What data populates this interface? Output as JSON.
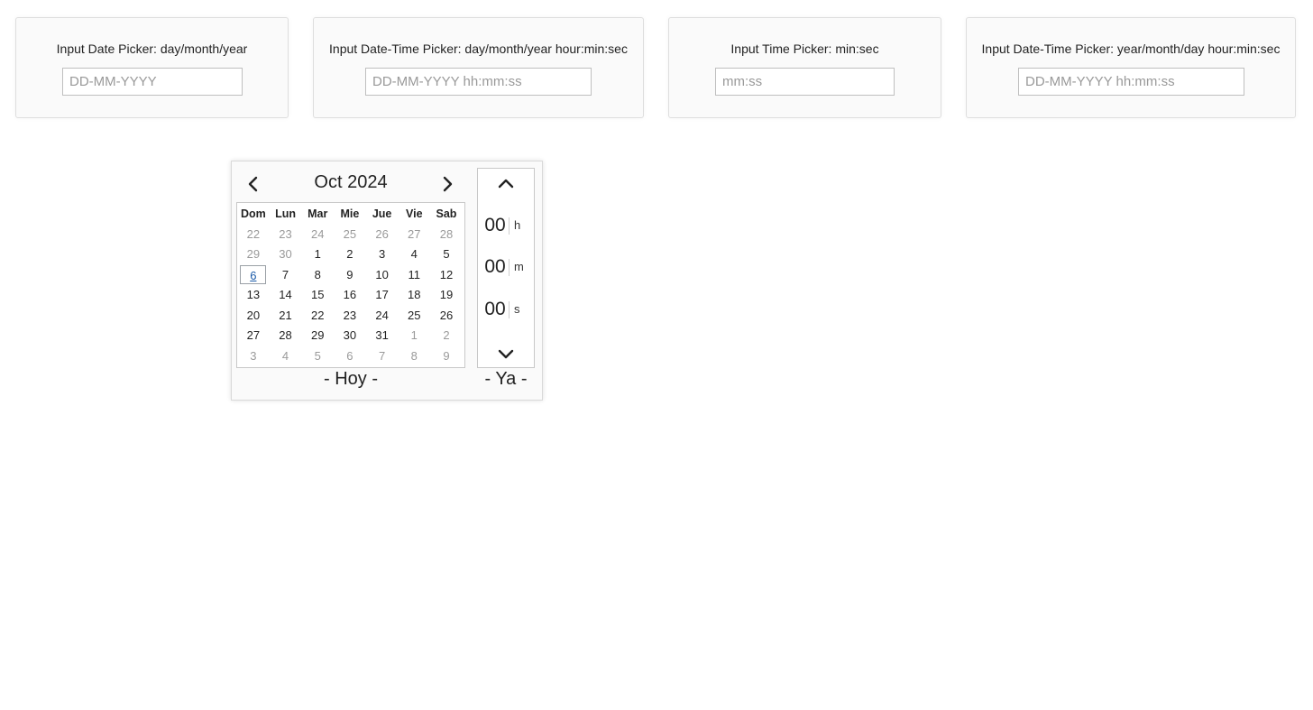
{
  "cards": [
    {
      "label": "Input Date Picker: day/month/year",
      "placeholder": "DD-MM-YYYY",
      "value": ""
    },
    {
      "label": "Input Date-Time Picker: day/month/year hour:min:sec",
      "placeholder": "DD-MM-YYYY hh:mm:ss",
      "value": ""
    },
    {
      "label": "Input Time Picker: min:sec",
      "placeholder": "mm:ss",
      "value": ""
    },
    {
      "label": "Input Date-Time Picker: year/month/day hour:min:sec",
      "placeholder": "DD-MM-YYYY hh:mm:ss",
      "value": ""
    }
  ],
  "picker": {
    "month_title": "Oct 2024",
    "prev_icon": "chevron-left-icon",
    "next_icon": "chevron-right-icon",
    "weekdays": [
      "Dom",
      "Lun",
      "Mar",
      "Mie",
      "Jue",
      "Vie",
      "Sab"
    ],
    "weeks": [
      [
        {
          "d": "22",
          "m": true
        },
        {
          "d": "23",
          "m": true
        },
        {
          "d": "24",
          "m": true
        },
        {
          "d": "25",
          "m": true
        },
        {
          "d": "26",
          "m": true
        },
        {
          "d": "27",
          "m": true
        },
        {
          "d": "28",
          "m": true
        }
      ],
      [
        {
          "d": "29",
          "m": true
        },
        {
          "d": "30",
          "m": true
        },
        {
          "d": "1"
        },
        {
          "d": "2"
        },
        {
          "d": "3"
        },
        {
          "d": "4"
        },
        {
          "d": "5"
        }
      ],
      [
        {
          "d": "6",
          "today": true
        },
        {
          "d": "7"
        },
        {
          "d": "8"
        },
        {
          "d": "9"
        },
        {
          "d": "10"
        },
        {
          "d": "11"
        },
        {
          "d": "12"
        }
      ],
      [
        {
          "d": "13"
        },
        {
          "d": "14"
        },
        {
          "d": "15"
        },
        {
          "d": "16"
        },
        {
          "d": "17"
        },
        {
          "d": "18"
        },
        {
          "d": "19"
        }
      ],
      [
        {
          "d": "20"
        },
        {
          "d": "21"
        },
        {
          "d": "22"
        },
        {
          "d": "23"
        },
        {
          "d": "24"
        },
        {
          "d": "25"
        },
        {
          "d": "26"
        }
      ],
      [
        {
          "d": "27"
        },
        {
          "d": "28"
        },
        {
          "d": "29"
        },
        {
          "d": "30"
        },
        {
          "d": "31"
        },
        {
          "d": "1",
          "m": true
        },
        {
          "d": "2",
          "m": true
        }
      ],
      [
        {
          "d": "3",
          "m": true
        },
        {
          "d": "4",
          "m": true
        },
        {
          "d": "5",
          "m": true
        },
        {
          "d": "6",
          "m": true
        },
        {
          "d": "7",
          "m": true
        },
        {
          "d": "8",
          "m": true
        },
        {
          "d": "9",
          "m": true
        }
      ]
    ],
    "time": {
      "up_icon": "chevron-up-icon",
      "down_icon": "chevron-down-icon",
      "hours": "00",
      "hours_unit": "h",
      "minutes": "00",
      "minutes_unit": "m",
      "seconds": "00",
      "seconds_unit": "s"
    },
    "today_label": "- Hoy -",
    "now_label": "- Ya -"
  },
  "colors": {
    "card_bg": "#fafafa",
    "today_link": "#1a5aa8",
    "muted_day": "#9a9a9a"
  }
}
